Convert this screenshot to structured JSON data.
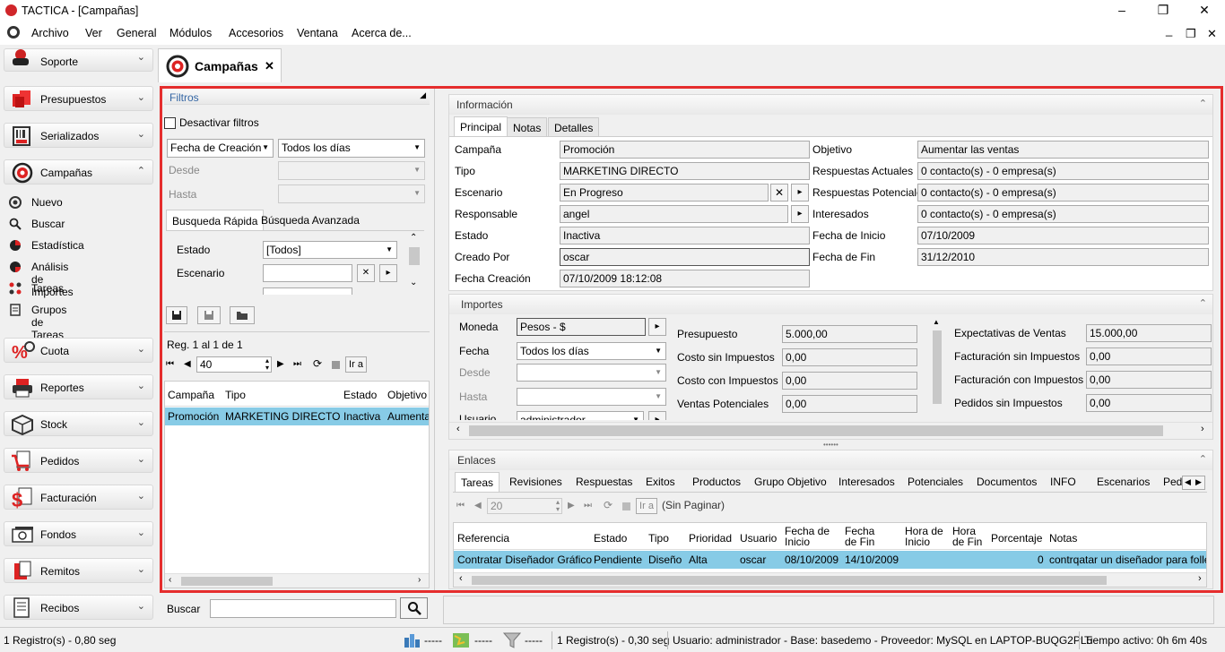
{
  "window": {
    "title": "TACTICA - [Campañas]",
    "min_label": "–",
    "max_label": "❐",
    "close_label": "✕"
  },
  "menu": [
    "Archivo",
    "Ver",
    "General",
    "Módulos",
    "Accesorios",
    "Ventana",
    "Acerca de..."
  ],
  "mdi": {
    "min": "_",
    "restore": "❐",
    "close": "✕"
  },
  "sidebar": {
    "modules_top": [
      {
        "label": "Soporte",
        "chev": "⌄"
      },
      {
        "label": "Presupuestos",
        "chev": "⌄"
      },
      {
        "label": "Serializados",
        "chev": "⌄"
      },
      {
        "label": "Campañas",
        "chev": "⌃"
      }
    ],
    "subitems": [
      "Nuevo",
      "Buscar",
      "Estadística",
      "Análisis de Importes",
      "Tareas",
      "Grupos de Tareas"
    ],
    "modules_bottom": [
      "Cuota",
      "Reportes",
      "Stock",
      "Pedidos",
      "Facturación",
      "Fondos",
      "Remitos",
      "Recibos"
    ]
  },
  "tab": {
    "label": "Campañas",
    "close": "✕"
  },
  "filters": {
    "title": "Filtros",
    "disable_label": "Desactivar filtros",
    "field_select": "Fecha de Creación",
    "period_select": "Todos los días",
    "desde": "Desde",
    "hasta": "Hasta",
    "tabs": [
      "Busqueda Rápida",
      "Búsqueda Avanzada"
    ],
    "estado_label": "Estado",
    "estado_value": "[Todos]",
    "escenario_label": "Escenario",
    "x": "✕",
    "arrow": "▸"
  },
  "nav": {
    "reg": "Reg. 1 al 1 de 1",
    "page_size": "40",
    "ira": "Ir a"
  },
  "list": {
    "headers": [
      "Campaña",
      "Tipo",
      "Estado",
      "Objetivo"
    ],
    "rows": [
      [
        "Promoción",
        "MARKETING DIRECTO",
        "Inactiva",
        "Aumentar"
      ]
    ]
  },
  "search": {
    "label": "Buscar",
    "value": ""
  },
  "info": {
    "title": "Información",
    "tabs": [
      "Principal",
      "Notas",
      "Detalles"
    ],
    "left": [
      {
        "label": "Campaña",
        "value": "Promoción"
      },
      {
        "label": "Tipo",
        "value": "MARKETING DIRECTO"
      },
      {
        "label": "Escenario",
        "value": "En Progreso"
      },
      {
        "label": "Responsable",
        "value": "angel"
      },
      {
        "label": "Estado",
        "value": "Inactiva"
      },
      {
        "label": "Creado Por",
        "value": "oscar"
      },
      {
        "label": "Fecha Creación",
        "value": "07/10/2009 18:12:08"
      }
    ],
    "right": [
      {
        "label": "Objetivo",
        "value": "Aumentar las ventas"
      },
      {
        "label": "Respuestas Actuales",
        "value": "0 contacto(s) - 0 empresa(s)"
      },
      {
        "label": "Respuestas Potenciales",
        "value": "0 contacto(s) - 0 empresa(s)"
      },
      {
        "label": "Interesados",
        "value": "0 contacto(s) - 0 empresa(s)"
      },
      {
        "label": "Fecha de Inicio",
        "value": "07/10/2009"
      },
      {
        "label": "Fecha de Fin",
        "value": "31/12/2010"
      }
    ]
  },
  "importes": {
    "title": "Importes",
    "left": [
      {
        "label": "Moneda",
        "value": "Pesos - $"
      },
      {
        "label": "Fecha",
        "value": "Todos los días"
      },
      {
        "label": "Desde",
        "value": ""
      },
      {
        "label": "Hasta",
        "value": ""
      },
      {
        "label": "Usuario",
        "value": "administrador"
      }
    ],
    "mid": [
      {
        "label": "Presupuesto",
        "value": "5.000,00"
      },
      {
        "label": "Costo sin Impuestos",
        "value": "0,00"
      },
      {
        "label": "Costo con Impuestos",
        "value": "0,00"
      },
      {
        "label": "Ventas Potenciales",
        "value": "0,00"
      }
    ],
    "right": [
      {
        "label": "Expectativas de Ventas",
        "value": "15.000,00"
      },
      {
        "label": "Facturación sin Impuestos",
        "value": "0,00"
      },
      {
        "label": "Facturación con Impuestos",
        "value": "0,00"
      },
      {
        "label": "Pedidos sin Impuestos",
        "value": "0,00"
      }
    ]
  },
  "enlaces": {
    "title": "Enlaces",
    "tabs": [
      "Tareas",
      "Revisiones",
      "Respuestas",
      "Exitos",
      "Productos",
      "Grupo Objetivo",
      "Interesados",
      "Potenciales",
      "Documentos",
      "INFO",
      "Escenarios",
      "Ped"
    ],
    "page": "20",
    "sin_paginar": "(Sin Paginar)",
    "ira": "Ir a",
    "headers": [
      "Referencia",
      "Estado",
      "Tipo",
      "Prioridad",
      "Usuario",
      "Fecha de Inicio",
      "Fecha de Fin",
      "Hora de Inicio",
      "Hora de Fin",
      "Porcentaje",
      "Notas"
    ],
    "rows": [
      [
        "Contratar Diseñador Gráfico",
        "Pendiente",
        "Diseño",
        "Alta",
        "oscar",
        "08/10/2009",
        "14/10/2009",
        "",
        "",
        "0",
        "contrqatar un diseñador para folleteria"
      ]
    ]
  },
  "status": {
    "left": "1 Registro(s) - 0,80 seg",
    "d1": "-----",
    "d2": "-----",
    "d3": "-----",
    "reg2": "1 Registro(s) - 0,30 seg",
    "info": "Usuario: administrador - Base: basedemo - Proveedor: MySQL en LAPTOP-BUQG2PL5",
    "uptime": "Tiempo activo: 0h 6m 40s"
  }
}
